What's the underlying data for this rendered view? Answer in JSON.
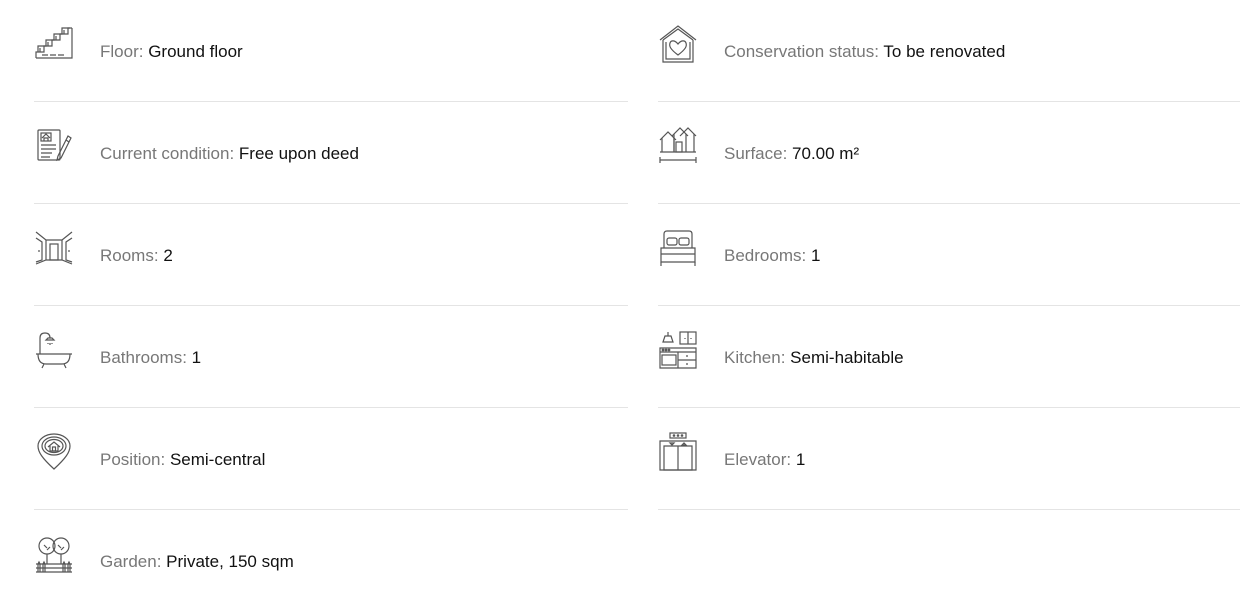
{
  "left": [
    {
      "label": "Floor:",
      "value": "Ground floor",
      "icon": "stairs-icon"
    },
    {
      "label": "Current condition:",
      "value": "Free upon deed",
      "icon": "deed-document-icon"
    },
    {
      "label": "Rooms:",
      "value": "2",
      "icon": "rooms-icon"
    },
    {
      "label": "Bathrooms:",
      "value": "1",
      "icon": "bathtub-icon"
    },
    {
      "label": "Position:",
      "value": "Semi-central",
      "icon": "location-pin-icon"
    },
    {
      "label": "Garden:",
      "value": "Private, 150 sqm",
      "icon": "garden-icon"
    }
  ],
  "right": [
    {
      "label": "Conservation status:",
      "value": "To be renovated",
      "icon": "house-heart-icon"
    },
    {
      "label": "Surface:",
      "value": "70.00 m²",
      "icon": "surface-houses-icon"
    },
    {
      "label": "Bedrooms:",
      "value": "1",
      "icon": "bed-icon"
    },
    {
      "label": "Kitchen:",
      "value": "Semi-habitable",
      "icon": "kitchen-icon"
    },
    {
      "label": "Elevator:",
      "value": "1",
      "icon": "elevator-icon"
    }
  ]
}
